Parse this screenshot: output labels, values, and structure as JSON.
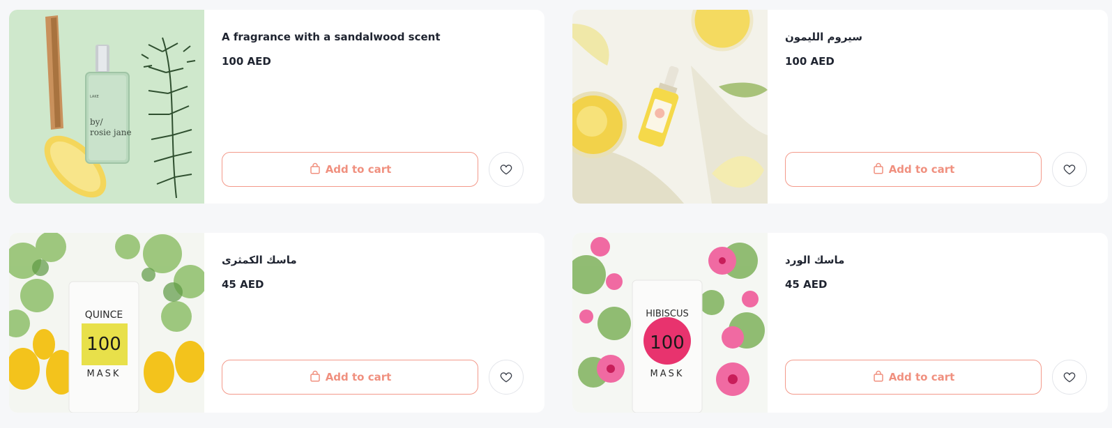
{
  "products": [
    {
      "title": "A fragrance with a sandalwood scent",
      "price": "100 AED",
      "add_to_cart_label": "Add to cart",
      "image_text": {
        "brand": "LAKE",
        "line1": "by/",
        "line2": "rosie jane"
      }
    },
    {
      "title": "سيروم الليمون",
      "price": "100 AED",
      "add_to_cart_label": "Add to cart"
    },
    {
      "title": "ماسك الكمثرى",
      "price": "45 AED",
      "add_to_cart_label": "Add to cart",
      "image_text": {
        "line1": "QUINCE",
        "line2": "100",
        "line3": "MASK"
      }
    },
    {
      "title": "ماسك الورد",
      "price": "45 AED",
      "add_to_cart_label": "Add to cart",
      "image_text": {
        "line1": "HIBISCUS",
        "line2": "100",
        "line3": "MASK"
      }
    }
  ],
  "icons": {
    "cart": "shopping-bag-icon",
    "wishlist": "heart-icon"
  },
  "colors": {
    "accent": "#f0907f",
    "background": "#f6f7f9",
    "card": "#ffffff",
    "text": "#1f2430"
  }
}
